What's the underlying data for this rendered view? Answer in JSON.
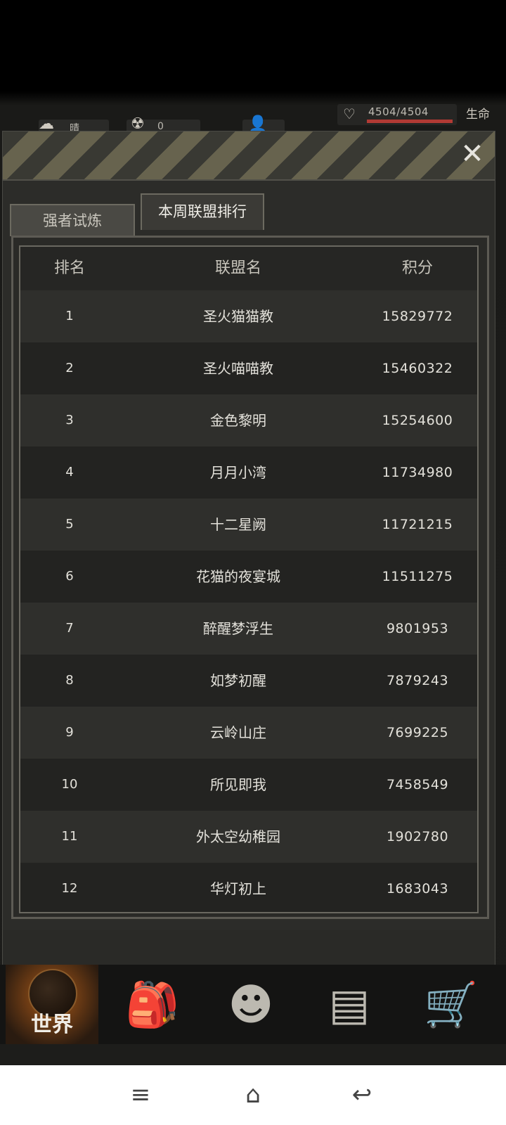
{
  "hud": {
    "weather": "晴",
    "radiation": "0",
    "hp": "4504/4504",
    "hp_label": "生命",
    "hp_fraction": 1.0
  },
  "tabs": [
    {
      "label": "强者试炼",
      "active": false
    },
    {
      "label": "本周联盟排行",
      "active": true
    }
  ],
  "table": {
    "headers": {
      "rank": "排名",
      "name": "联盟名",
      "score": "积分"
    },
    "rows": [
      {
        "rank": "1",
        "name": "圣火猫猫教",
        "score": "15829772"
      },
      {
        "rank": "2",
        "name": "圣火喵喵教",
        "score": "15460322"
      },
      {
        "rank": "3",
        "name": "金色黎明",
        "score": "15254600"
      },
      {
        "rank": "4",
        "name": "月月小湾",
        "score": "11734980"
      },
      {
        "rank": "5",
        "name": "十二星阙",
        "score": "11721215"
      },
      {
        "rank": "6",
        "name": "花猫的夜宴城",
        "score": "11511275"
      },
      {
        "rank": "7",
        "name": "醉醒梦浮生",
        "score": "9801953"
      },
      {
        "rank": "8",
        "name": "如梦初醒",
        "score": "7879243"
      },
      {
        "rank": "9",
        "name": "云岭山庄",
        "score": "7699225"
      },
      {
        "rank": "10",
        "name": "所见即我",
        "score": "7458549"
      },
      {
        "rank": "11",
        "name": "外太空幼稚园",
        "score": "1902780"
      },
      {
        "rank": "12",
        "name": "华灯初上",
        "score": "1683043"
      }
    ]
  },
  "bottom_nav": {
    "world_label": "世界",
    "items": [
      "backpack-icon",
      "skills-head-icon",
      "phone-icon",
      "cart-icon"
    ]
  },
  "colors": {
    "hp_bar": "#b23a34",
    "accent_world": "#a85a18"
  }
}
